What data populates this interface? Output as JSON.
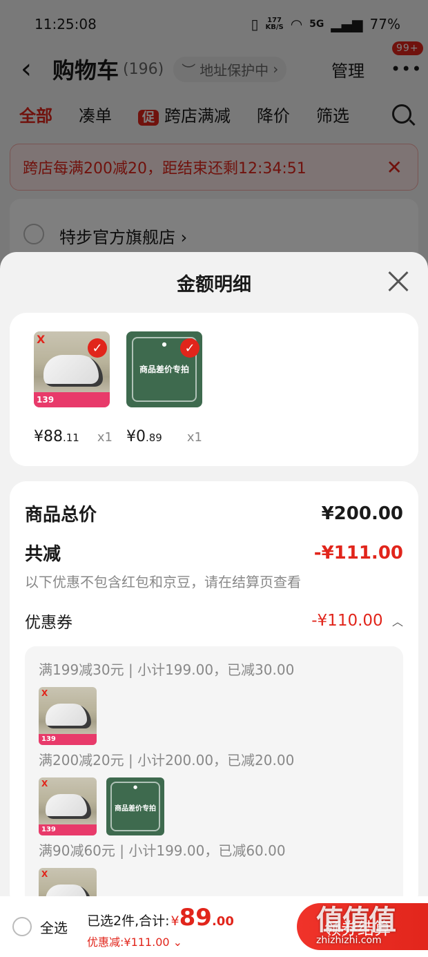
{
  "status_bar": {
    "time": "11:25:08",
    "net_speed_value": "177",
    "net_speed_unit": "KB/S",
    "network_type": "5G",
    "battery": "77%"
  },
  "nav": {
    "title": "购物车",
    "count": "(196)",
    "address_chip": "地址保护中",
    "manage": "管理",
    "message_badge": "99+"
  },
  "tabs": {
    "all": "全部",
    "bundle": "凑单",
    "promo_tag": "促",
    "cross_store": "跨店满减",
    "price_drop": "降价",
    "filter": "筛选"
  },
  "banner": {
    "text": "跨店每满200减20，距结束还剩12:34:51"
  },
  "shop": {
    "name": "特步官方旗舰店"
  },
  "sheet": {
    "title": "金额明细",
    "items": [
      {
        "price_main": "¥88",
        "price_decimal": ".11",
        "qty": "x1",
        "thumb_label": "139"
      },
      {
        "price_main": "¥0",
        "price_decimal": ".89",
        "qty": "x1",
        "thumb_label": "商品差价专拍"
      }
    ],
    "total_label": "商品总价",
    "total_value": "¥200.00",
    "reduction_label": "共减",
    "reduction_value": "-¥111.00",
    "reduction_note": "以下优惠不包含红包和京豆，请在结算页查看",
    "coupon_label": "优惠券",
    "coupon_value": "-¥110.00",
    "coupon_rules": [
      "满199减30元 | 小计199.00，已减30.00",
      "满200减20元 | 小计200.00，已减20.00",
      "满90减60元 | 小计199.00，已减60.00"
    ]
  },
  "bottom_bar": {
    "select_all": "全选",
    "selected_text": "已选2件,合计:",
    "currency": "¥",
    "total_int": "89",
    "total_dec": ".00",
    "discount_text": "优惠减:¥111.00",
    "checkout": "领券结算"
  },
  "watermark": {
    "chars": "值值值",
    "url": "zhizhizhi.com"
  },
  "colors": {
    "accent": "#e1251b",
    "sheet_bg": "#f2f2f2"
  }
}
